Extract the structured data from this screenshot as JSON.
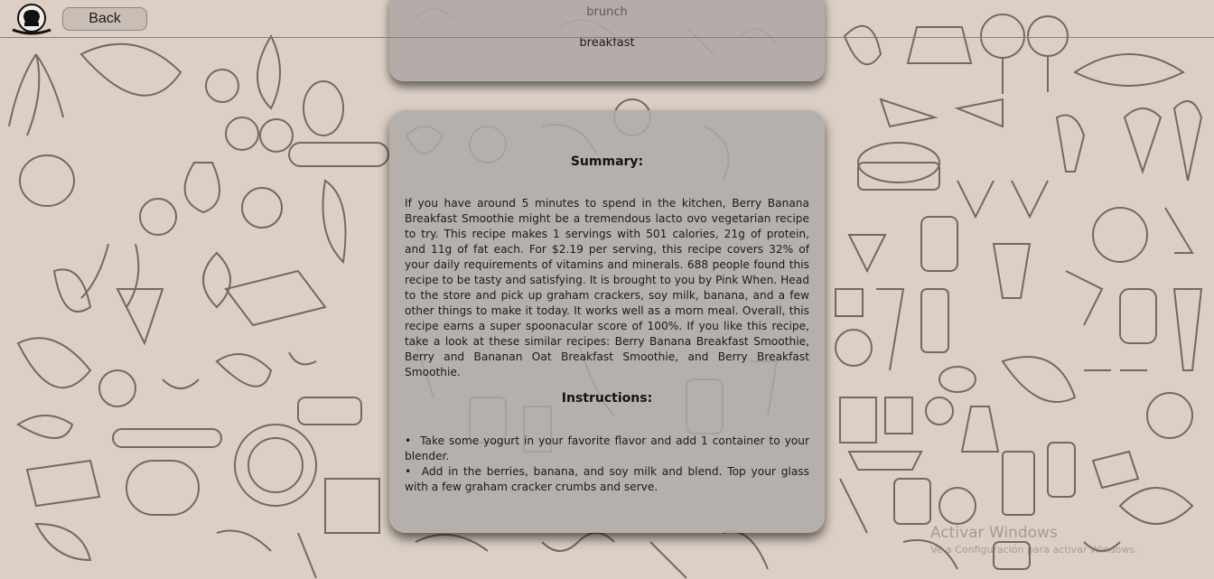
{
  "header": {
    "back_label": "Back",
    "logo_icon": "chef-hat-logo-icon"
  },
  "tags": {
    "items": [
      "brunch",
      "breakfast"
    ]
  },
  "recipe": {
    "summary_heading": "Summary:",
    "summary_text": "If you have around 5 minutes to spend in the kitchen, Berry Banana Breakfast Smoothie might be a tremendous lacto ovo vegetarian recipe to try. This recipe makes 1 servings with 501 calories, 21g of protein, and 11g of fat each. For $2.19 per serving, this recipe covers 32% of your daily requirements of vitamins and minerals. 688 people found this recipe to be tasty and satisfying. It is brought to you by Pink When. Head to the store and pick up graham crackers, soy milk, banana, and a few other things to make it today. It works well as a morn meal. Overall, this recipe earns a super spoonacular score of 100%. If you like this recipe, take a look at these similar recipes: Berry Banana Breakfast Smoothie, Berry and Bananan Oat Breakfast Smoothie, and Berry Breakfast Smoothie.",
    "instructions_heading": "Instructions:",
    "steps": [
      "Take some yogurt in your favorite flavor and add 1 container to your blender.",
      "Add in the berries, banana, and soy milk and blend. Top your glass with a few graham cracker crumbs and serve."
    ]
  },
  "watermark": {
    "title": "Activar Windows",
    "subtitle": "Ve a Configuración para activar Windows."
  },
  "colors": {
    "background": "#dcd0c6",
    "card": "#afa8a6",
    "doodle": "#6e625b"
  }
}
